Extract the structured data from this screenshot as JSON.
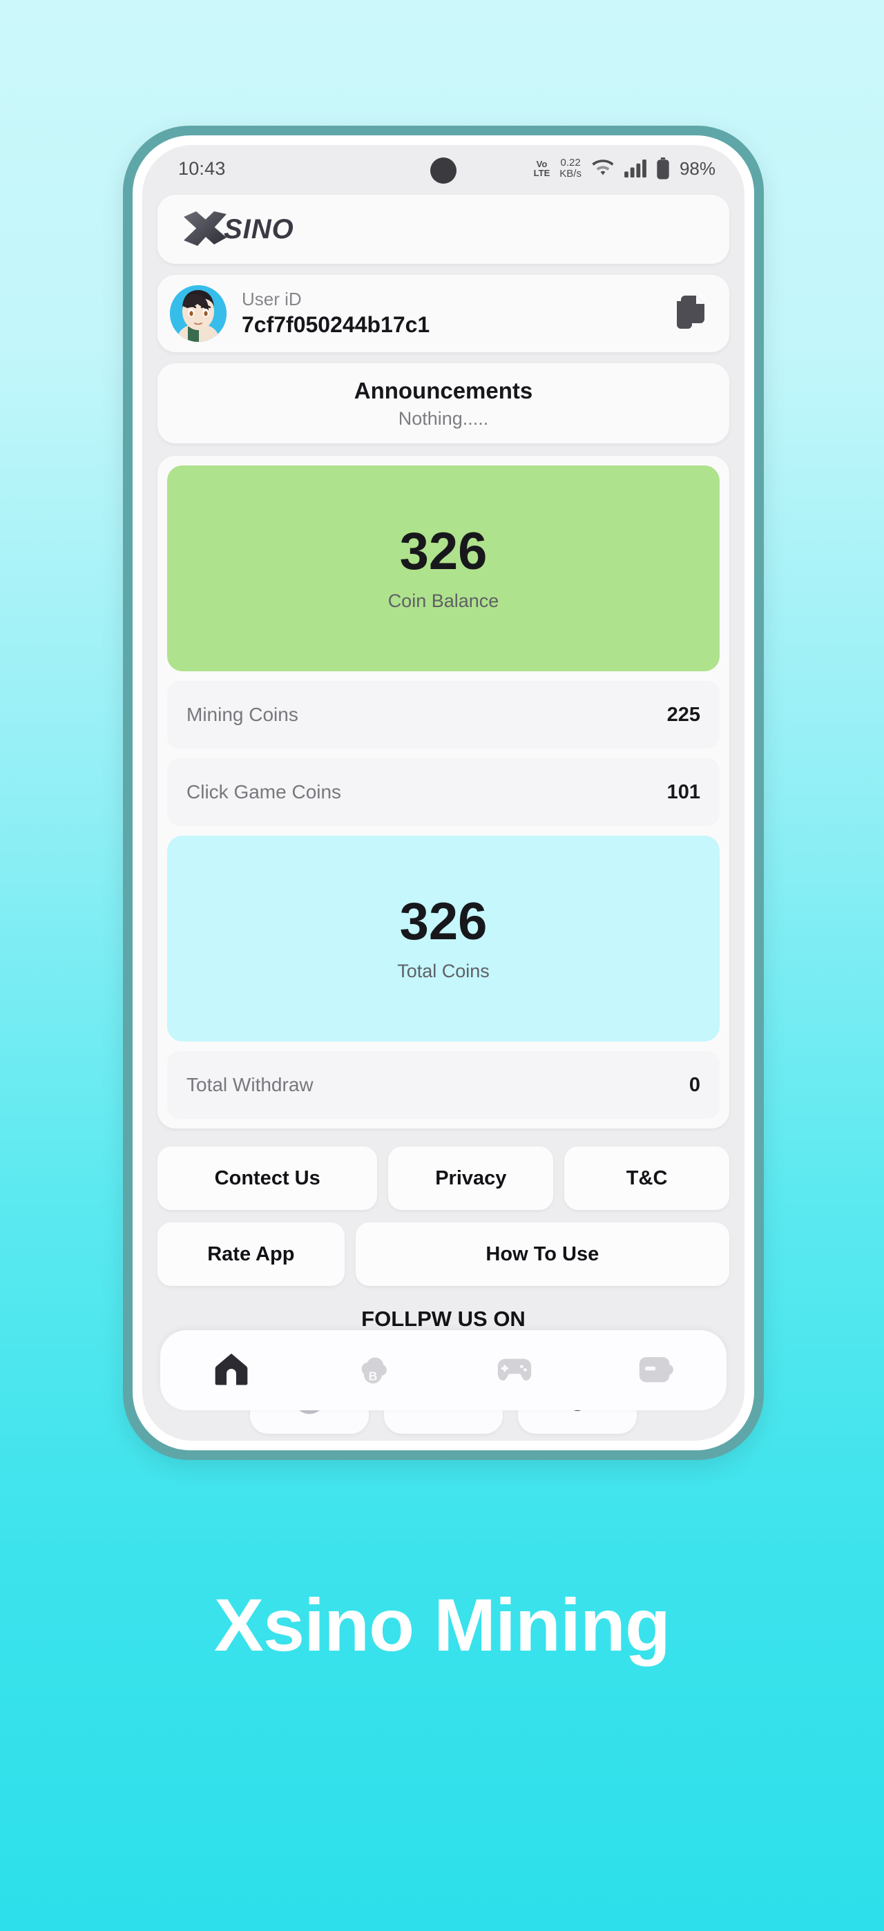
{
  "background": {
    "top_color": "#CCF8FB",
    "bottom_color": "#2CDFEA"
  },
  "phone": {
    "frame_color": "#5FA6A8",
    "screen_bg": "#EDECEE"
  },
  "status_bar": {
    "time": "10:43",
    "volte_top": "Vo",
    "volte_bottom": "LTE",
    "net_speed_value": "0.22",
    "net_speed_unit": "KB/s",
    "wifi_icon": "wifi-icon",
    "signal_icon": "cellular-signal-icon",
    "battery_icon": "battery-icon",
    "battery_percent": "98%"
  },
  "app_bar": {
    "logo_x": "X",
    "logo_text": "SINO",
    "logo_name": "xsino-logo"
  },
  "user": {
    "label": "User iD",
    "id": "7cf7f050244b17c1",
    "copy_icon": "copy-icon",
    "avatar_name": "user-avatar"
  },
  "announcements": {
    "title": "Announcements",
    "message": "Nothing....."
  },
  "stats": {
    "coin_balance": {
      "value": "326",
      "label": "Coin Balance",
      "color": "#AFE28C"
    },
    "rows_top": [
      {
        "name": "Mining Coins",
        "value": "225"
      },
      {
        "name": "Click Game Coins",
        "value": "101"
      }
    ],
    "total_coins": {
      "value": "326",
      "label": "Total Coins",
      "color": "#C5F7FC"
    },
    "rows_bottom": [
      {
        "name": "Total Withdraw",
        "value": "0"
      }
    ]
  },
  "links": {
    "row1": [
      {
        "label": "Contect Us"
      },
      {
        "label": "Privacy"
      },
      {
        "label": "T&C"
      }
    ],
    "row2": [
      {
        "label": "Rate App"
      },
      {
        "label": "How To Use"
      }
    ]
  },
  "follow": {
    "title": "FOLLPW US ON",
    "items": [
      {
        "icon": "social-icon-1"
      },
      {
        "icon": "social-icon-2"
      },
      {
        "icon": "social-icon-3"
      }
    ]
  },
  "bottom_nav": {
    "items": [
      {
        "name": "nav-home",
        "icon": "home-icon",
        "active": true
      },
      {
        "name": "nav-mining",
        "icon": "cloud-bitcoin-icon",
        "active": false
      },
      {
        "name": "nav-games",
        "icon": "gamepad-icon",
        "active": false
      },
      {
        "name": "nav-wallet",
        "icon": "wallet-icon",
        "active": false
      }
    ],
    "active_color": "#2B2B31",
    "inactive_color": "#D2D2D7"
  },
  "caption": {
    "text": "Xsino Mining",
    "color": "#FFFFFF"
  }
}
